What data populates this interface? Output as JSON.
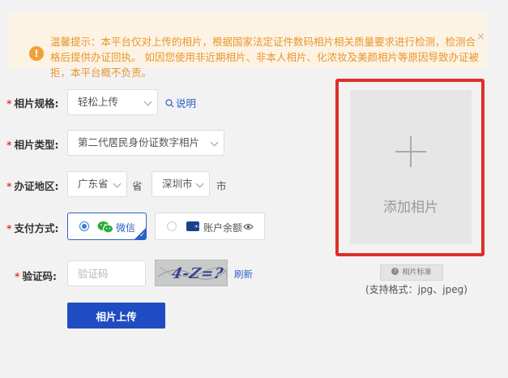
{
  "notice": {
    "text": "温馨提示：本平台仅对上传的相片，根据国家法定证件数码相片相关质量要求进行检测，检测合格后提供办证回执。 如因您使用非近期相片、非本人相片、化浓妆及美颜相片等原因导致办证被拒，本平台概不负责。",
    "icon_glyph": "!",
    "close_glyph": "×"
  },
  "form": {
    "spec": {
      "label": "相片规格:",
      "value": "轻松上传",
      "help_link": "说明"
    },
    "type": {
      "label": "相片类型:",
      "value": "第二代居民身份证数字相片"
    },
    "region": {
      "label": "办证地区:",
      "province_value": "广东省",
      "province_suffix": "省",
      "city_value": "深圳市",
      "city_suffix": "市"
    },
    "payment": {
      "label": "支付方式:",
      "options": [
        {
          "label": "微信",
          "selected": true,
          "icon": "wechat-icon"
        },
        {
          "label": "账户余额",
          "selected": false,
          "icon": "wallet-icon"
        }
      ]
    },
    "captcha": {
      "label": "验证码:",
      "placeholder": "验证码",
      "image_text": "4-Z=?",
      "refresh_link": "刷新"
    },
    "submit_label": "相片上传",
    "required_mark": "*"
  },
  "photo": {
    "add_label": "添加相片",
    "standard_button": "相片标准",
    "formats": "(支持格式：jpg、jpeg)"
  },
  "colors": {
    "accent": "#1f4cc2",
    "link": "#2f5fc7",
    "notice_text": "#e9952c",
    "notice_bg": "#fdf3e4",
    "highlight_frame": "#e02e28",
    "wechat_green": "#2aae3b"
  }
}
